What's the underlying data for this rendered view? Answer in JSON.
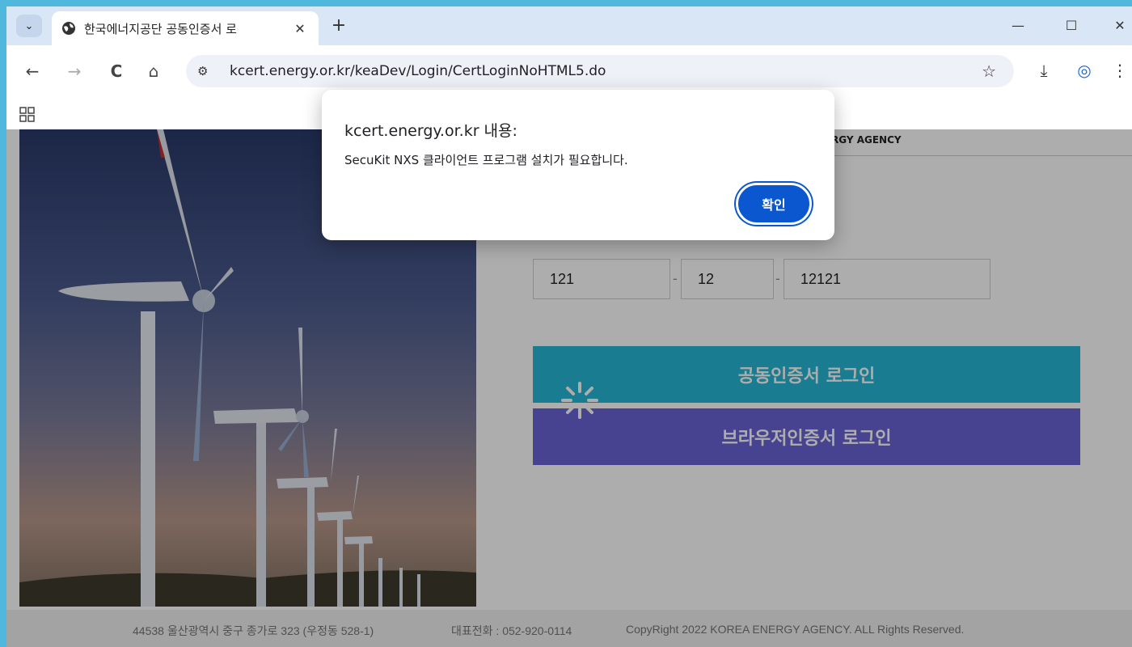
{
  "browser": {
    "tab_search_icon": "chevron-down-icon",
    "tab_title": "한국에너지공단 공동인증서 로",
    "tab_close": "✕",
    "new_tab": "+",
    "minimize": "—",
    "maximize": "☐",
    "close": "✕",
    "back": "←",
    "forward": "→",
    "reload": "C",
    "home": "⌂",
    "site_info": "⚙",
    "url": "kcert.energy.or.kr/keaDev/Login/CertLoginNoHTML5.do",
    "bookmark_star": "☆",
    "download": "⤓",
    "profile": "◎",
    "menu": "⋮"
  },
  "page": {
    "agency_label": "RGY AGENCY",
    "business_number": [
      "121",
      "12",
      "12121"
    ],
    "dash": "-",
    "cert_login_label": "공동인증서 로그인",
    "browser_cert_login_label": "브라우저인증서 로그인",
    "footer": {
      "address": "44538 울산광역시 중구 종가로 323 (우정동 528-1)",
      "phone": "대표전화 : 052-920-0114",
      "copyright": "CopyRight 2022 KOREA ENERGY AGENCY. ALL Rights Reserved."
    }
  },
  "dialog": {
    "title": "kcert.energy.or.kr 내용:",
    "message": "SecuKit NXS 클라이언트 프로그램 설치가 필요합니다.",
    "ok_label": "확인"
  },
  "colors": {
    "cert_button": "#25b7d6",
    "browser_cert_button": "#6a63d6",
    "dialog_button": "#0b57d0"
  }
}
